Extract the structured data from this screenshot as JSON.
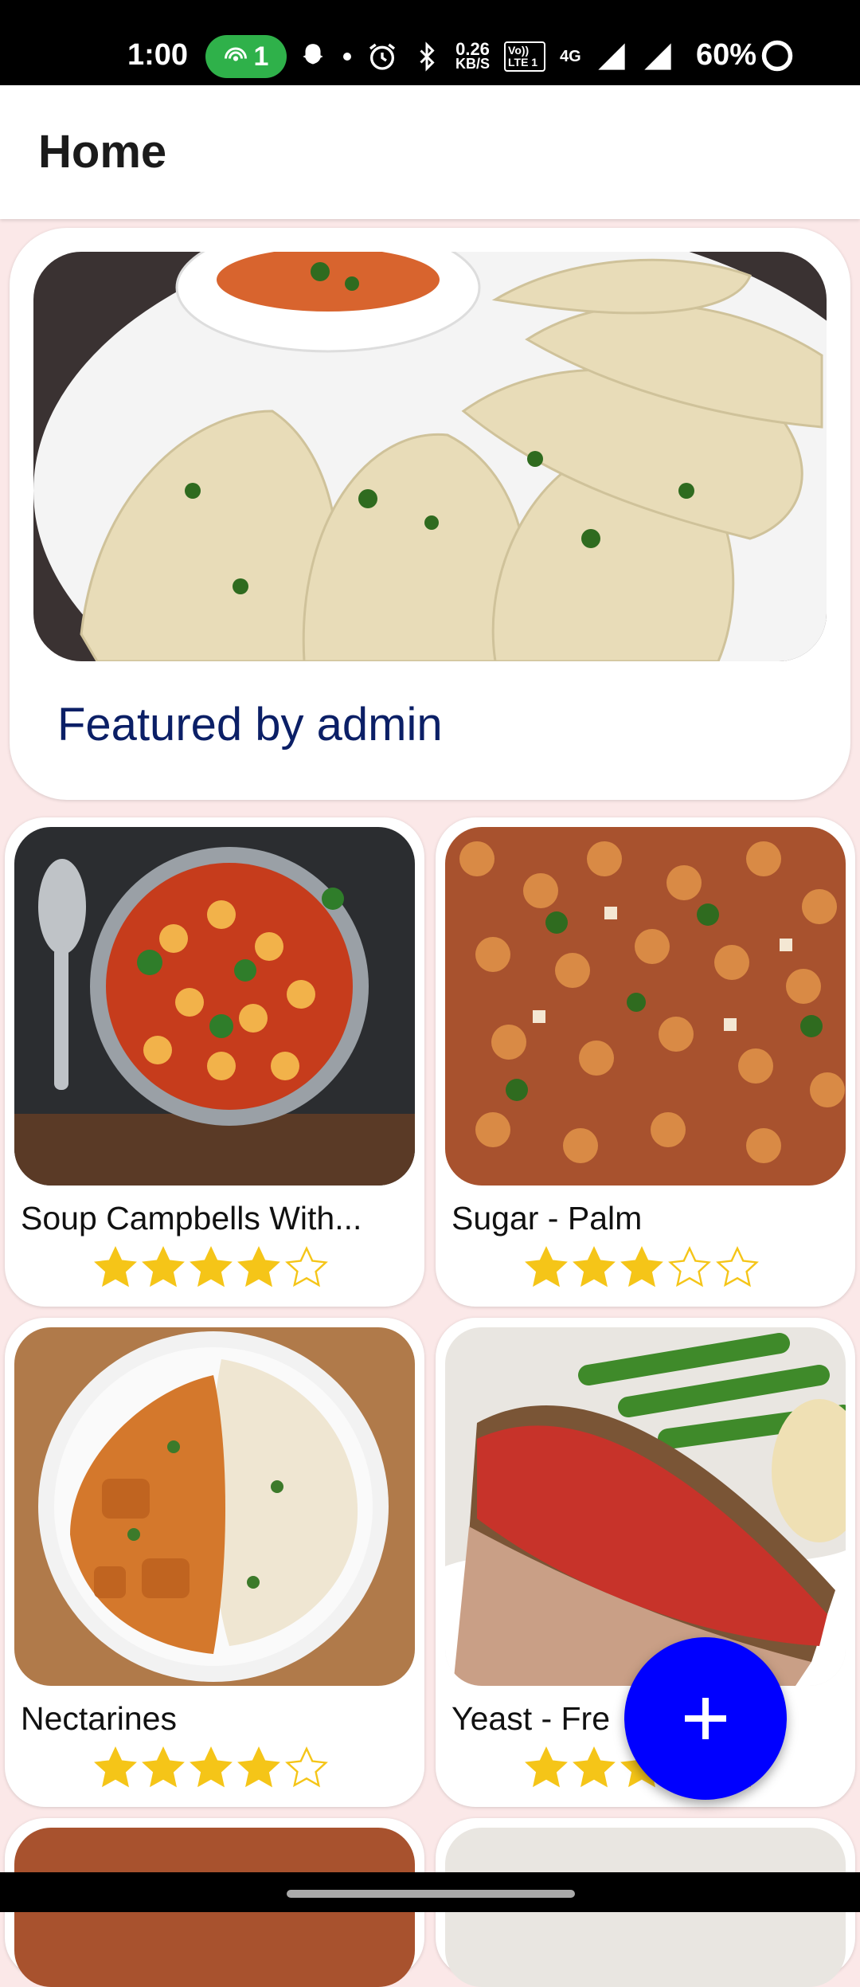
{
  "status_bar": {
    "time": "1:00",
    "hotspot_count": "1",
    "net_speed_value": "0.26",
    "net_speed_unit": "KB/S",
    "volte": "Vo)) LTE 1",
    "signal_label": "4G",
    "battery": "60%"
  },
  "app_bar": {
    "title": "Home"
  },
  "featured": {
    "caption": "Featured by admin",
    "image": "momo dumplings with red chutney"
  },
  "recipes": [
    {
      "name": "Soup Campbells  With...",
      "rating": 4,
      "image": "baked gnocchi in pan"
    },
    {
      "name": "Sugar - Palm",
      "rating": 3,
      "image": "chili mac with jalapenos"
    },
    {
      "name": "Nectarines",
      "rating": 4,
      "image": "butter chicken with rice"
    },
    {
      "name": "Yeast - Fre",
      "rating": 3,
      "image": "meatloaf with green beans"
    }
  ],
  "fab": {
    "icon": "plus-icon"
  },
  "colors": {
    "accent": "#0000ff",
    "featured_text": "#0b1f66",
    "star": "#f5c518",
    "background": "#fbe8e8"
  }
}
